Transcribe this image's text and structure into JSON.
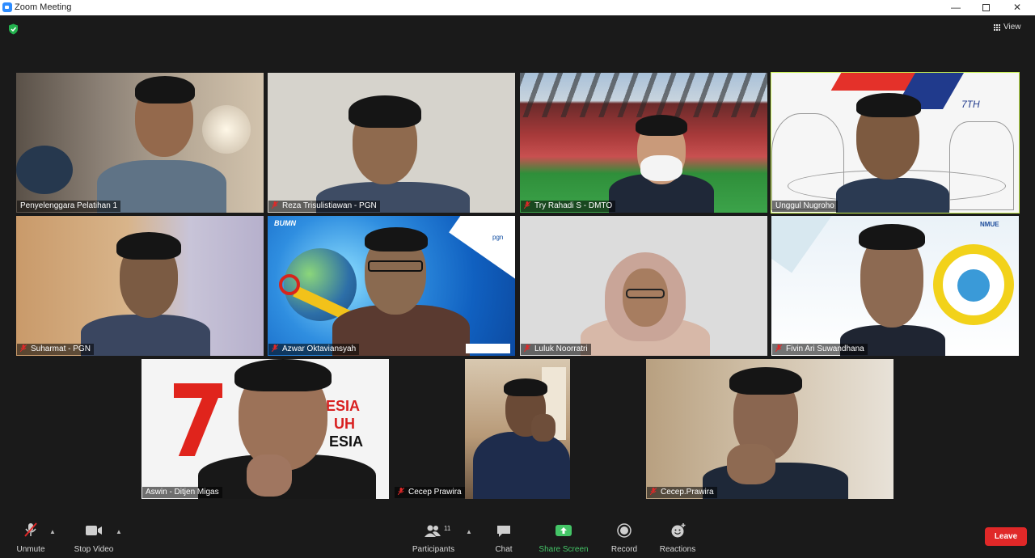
{
  "window": {
    "title": "Zoom Meeting",
    "minimize": "—",
    "close": "✕"
  },
  "top": {
    "view_label": "View"
  },
  "participants_grid": [
    {
      "name": "Penyelenggara Pelatihan 1",
      "muted": false,
      "active_speaker": false
    },
    {
      "name": "Reza Trisulistiawan - PGN",
      "muted": true,
      "active_speaker": false
    },
    {
      "name": "Try Rahadi S - DMTO",
      "muted": true,
      "active_speaker": false
    },
    {
      "name": "Unggul Nugroho",
      "muted": false,
      "active_speaker": true
    },
    {
      "name": "Suharmat - PGN",
      "muted": true,
      "active_speaker": false
    },
    {
      "name": "Azwar Oktaviansyah",
      "muted": true,
      "active_speaker": false
    },
    {
      "name": "Luluk Noorratri",
      "muted": true,
      "active_speaker": false
    },
    {
      "name": "Fivin Ari Suwandhana",
      "muted": true,
      "active_speaker": false
    },
    {
      "name": "Aswin - Ditjen Migas",
      "muted": false,
      "active_speaker": false
    },
    {
      "name": "Cecep Prawira",
      "muted": true,
      "active_speaker": false
    },
    {
      "name": "Cecep.Prawira",
      "muted": true,
      "active_speaker": false
    }
  ],
  "backgrounds": {
    "bumn_logo": "BUMN",
    "pgn_logo": "pgn",
    "nmue_logo": "NMUE",
    "seventh_mark": "7TH",
    "ri76_text_1": "ESIA",
    "ri76_text_2": "UH",
    "ri76_text_3": "ESIA"
  },
  "toolbar": {
    "unmute": "Unmute",
    "stop_video": "Stop Video",
    "participants": "Participants",
    "participants_count": "11",
    "chat": "Chat",
    "share_screen": "Share Screen",
    "record": "Record",
    "reactions": "Reactions",
    "leave": "Leave"
  },
  "colors": {
    "active_speaker_border": "#c8f050",
    "share_green": "#44c567",
    "leave_red": "#e02828",
    "muted_red": "#e02828",
    "security_green": "#23b14d"
  }
}
